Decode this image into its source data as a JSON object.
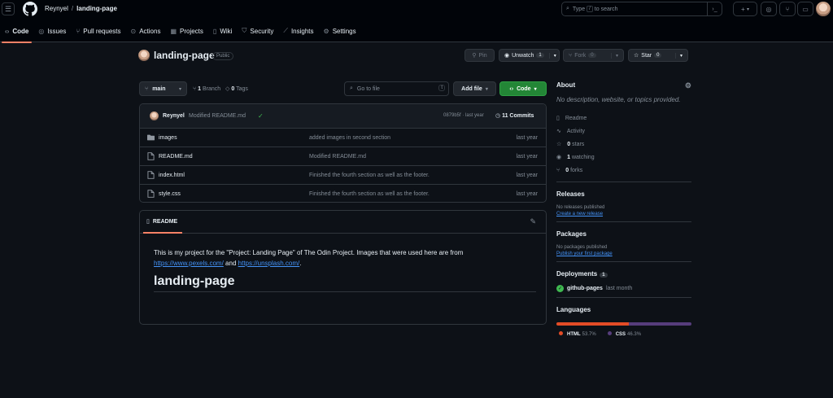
{
  "header": {
    "owner": "Reynyel",
    "separator": "/",
    "repo": "landing-page",
    "search_placeholder_start": "Type",
    "search_key": "/",
    "search_placeholder_end": "to search",
    "plus_label": "+",
    "plus_caret": "▾"
  },
  "tabs": [
    {
      "label": "Code",
      "icon": "code-icon"
    },
    {
      "label": "Issues",
      "icon": "issue-icon"
    },
    {
      "label": "Pull requests",
      "icon": "pull-request-icon"
    },
    {
      "label": "Actions",
      "icon": "play-icon"
    },
    {
      "label": "Projects",
      "icon": "table-icon"
    },
    {
      "label": "Wiki",
      "icon": "book-icon"
    },
    {
      "label": "Security",
      "icon": "shield-icon"
    },
    {
      "label": "Insights",
      "icon": "graph-icon"
    },
    {
      "label": "Settings",
      "icon": "gear-icon"
    }
  ],
  "repo_header": {
    "name": "landing-page",
    "visibility": "Public",
    "pin": "Pin",
    "unwatch": "Unwatch",
    "watch_count": "1",
    "fork": "Fork",
    "fork_count": "0",
    "star": "Star",
    "star_count": "0"
  },
  "toolbar": {
    "branch": "main",
    "branches_count": "1",
    "branches_label": "Branch",
    "tags_count": "0",
    "tags_label": "Tags",
    "goto_placeholder": "Go to file",
    "goto_key": "t",
    "add_file": "Add file",
    "code": "Code"
  },
  "commit": {
    "author": "Reynyel",
    "message": "Modified README.md",
    "hash": "0879b5f · last year",
    "commits_count": "11",
    "commits_label": "Commits"
  },
  "files": [
    {
      "type": "folder",
      "name": "images",
      "message": "added images in second section",
      "date": "last year"
    },
    {
      "type": "file",
      "name": "README.md",
      "message": "Modified README.md",
      "date": "last year"
    },
    {
      "type": "file",
      "name": "index.html",
      "message": "Finished the fourth section as well as the footer.",
      "date": "last year"
    },
    {
      "type": "file",
      "name": "style.css",
      "message": "Finished the fourth section as well as the footer.",
      "date": "last year"
    }
  ],
  "readme": {
    "tab": "README",
    "text_before": "This is my project for the \"Project: Landing Page\" of The Odin Project. Images that were used here are from",
    "link1": "https://www.pexels.com/",
    "and": "and",
    "link2": "https://unsplash.com/",
    "period": ".",
    "heading": "landing-page"
  },
  "about": {
    "title": "About",
    "description": "No description, website, or topics provided.",
    "readme": "Readme",
    "activity": "Activity",
    "stars_count": "0",
    "stars_label": "stars",
    "watching_count": "1",
    "watching_label": "watching",
    "forks_count": "0",
    "forks_label": "forks"
  },
  "releases": {
    "title": "Releases",
    "none": "No releases published",
    "link": "Create a new release"
  },
  "packages": {
    "title": "Packages",
    "none": "No packages published",
    "link": "Publish your first package"
  },
  "deployments": {
    "title": "Deployments",
    "count": "1",
    "name": "github-pages",
    "when": "last month"
  },
  "languages": {
    "title": "Languages",
    "items": [
      {
        "name": "HTML",
        "percent": "53.7%",
        "value": 53.7,
        "color": "#e34c26"
      },
      {
        "name": "CSS",
        "percent": "46.3%",
        "value": 46.3,
        "color": "#563d7c"
      }
    ]
  }
}
